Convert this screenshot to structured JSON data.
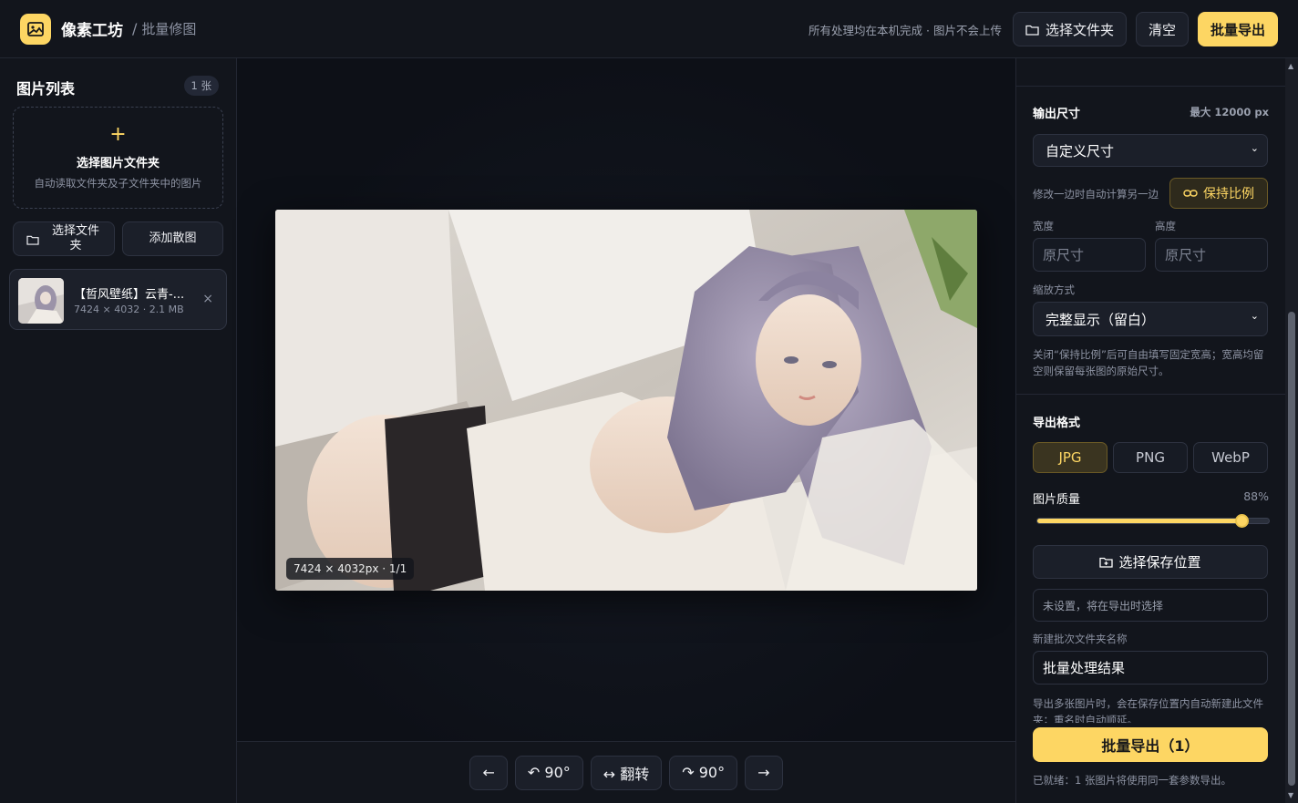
{
  "header": {
    "app_title": "像素工坊",
    "breadcrumb_sep": "/",
    "breadcrumb": "批量修图",
    "privacy_note": "所有处理均在本机完成 · 图片不会上传",
    "choose_folder_label": "选择文件夹",
    "clear_label": "清空",
    "batch_export_label": "批量导出"
  },
  "sidebar": {
    "title": "图片列表",
    "count_badge": "1 张",
    "dropzone_plus": "+",
    "dropzone_title": "选择图片文件夹",
    "dropzone_sub": "自动读取文件夹及子文件夹中的图片",
    "choose_folder_btn": "选择文件夹",
    "add_files_btn": "添加散图",
    "files": [
      {
        "name": "【哲风壁纸】云青-...",
        "meta": "7424 × 4032 · 2.1 MB",
        "remove": "×"
      }
    ]
  },
  "preview": {
    "size_tag": "7424 × 4032px · 1/1"
  },
  "toolbar": {
    "prev": "←",
    "rotate_left": "↶ 90°",
    "flip": "↔ 翻转",
    "rotate_right": "↷ 90°",
    "next": "→"
  },
  "panel": {
    "output_size_title": "输出尺寸",
    "max_size_note": "最大 12000 px",
    "size_mode": "自定义尺寸",
    "ratio_hint": "修改一边时自动计算另一边",
    "keep_ratio_label": "保持比例",
    "width_label": "宽度",
    "height_label": "高度",
    "width_placeholder": "原尺寸",
    "height_placeholder": "原尺寸",
    "scale_mode_label": "缩放方式",
    "scale_mode": "完整显示（留白）",
    "scale_hint": "关闭“保持比例”后可自由填写固定宽高；宽高均留空则保留每张图的原始尺寸。",
    "format_title": "导出格式",
    "formats": [
      "JPG",
      "PNG",
      "WebP"
    ],
    "active_format": "JPG",
    "quality_label": "图片质量",
    "quality_value_text": "88%",
    "quality": 0.88,
    "save_location_btn": "选择保存位置",
    "save_location_value": "未设置，将在导出时选择",
    "batch_folder_label": "新建批次文件夹名称",
    "batch_folder_value": "批量处理结果",
    "batch_folder_hint": "导出多张图片时，会在保存位置内自动新建此文件夹；重名时自动顺延。",
    "export_btn": "批量导出（1）",
    "ready_status": "已就绪：1 张图片将使用同一套参数导出。"
  },
  "colors": {
    "accent": "#fdd663",
    "background": "#0f1219",
    "panel": "#12151c"
  }
}
